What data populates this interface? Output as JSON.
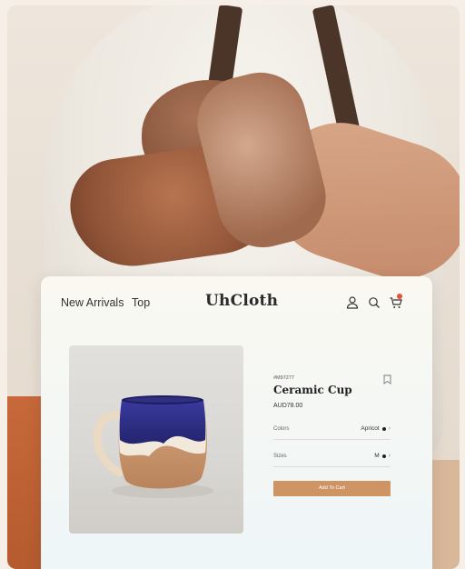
{
  "nav": {
    "links": [
      "New Arrivals",
      "Top"
    ],
    "brand": "UhCloth",
    "icons": [
      "user-icon",
      "search-icon",
      "cart-icon"
    ]
  },
  "product": {
    "sku": "#M97277",
    "name": "Ceramic Cup",
    "price": "AUD78.00",
    "options": [
      {
        "label": "Colors",
        "value": "Apricot"
      },
      {
        "label": "Sizes",
        "value": "M"
      }
    ],
    "add_to_cart": "Add To Cart"
  },
  "colors": {
    "accent": "#cf9464",
    "cart_badge": "#e6513a",
    "glaze_blue": "#2e2f8f"
  }
}
